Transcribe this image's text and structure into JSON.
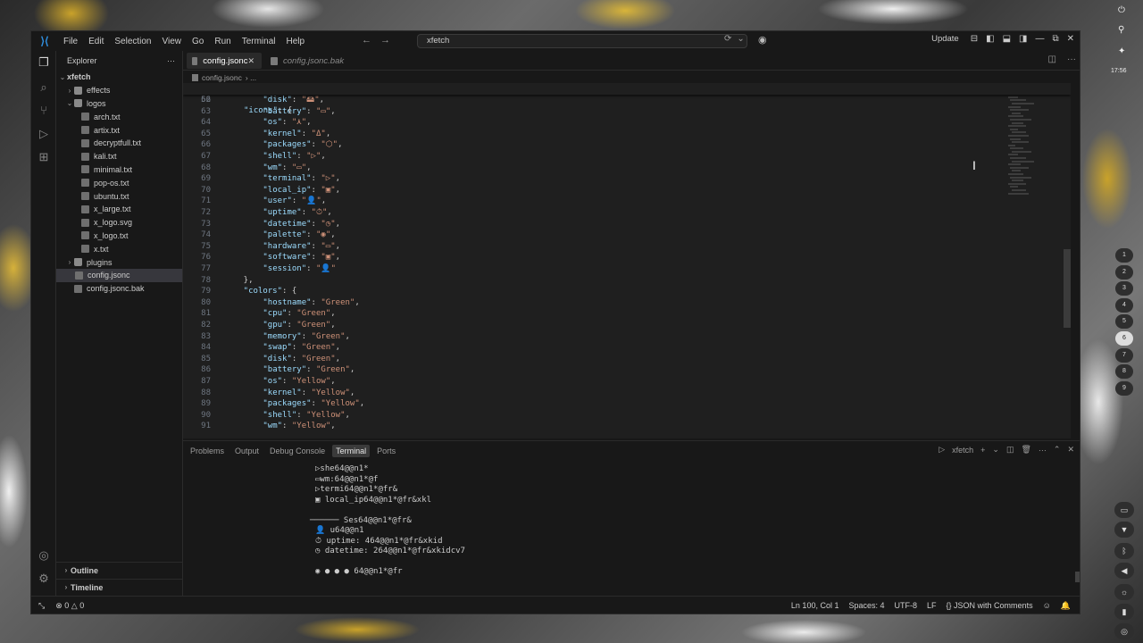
{
  "titlebar": {
    "menu": [
      "File",
      "Edit",
      "Selection",
      "View",
      "Go",
      "Run",
      "Terminal",
      "Help"
    ],
    "search_text": "xfetch",
    "update_label": "Update"
  },
  "sidebar": {
    "title": "Explorer",
    "more": "···",
    "root": "xfetch",
    "tree": [
      {
        "label": "effects",
        "kind": "folder",
        "depth": 1,
        "twisty": "›"
      },
      {
        "label": "logos",
        "kind": "folder",
        "depth": 1,
        "twisty": "⌄"
      },
      {
        "label": "arch.txt",
        "kind": "txt",
        "depth": 2
      },
      {
        "label": "artix.txt",
        "kind": "txt",
        "depth": 2
      },
      {
        "label": "decryptfull.txt",
        "kind": "txt",
        "depth": 2
      },
      {
        "label": "kali.txt",
        "kind": "txt",
        "depth": 2
      },
      {
        "label": "minimal.txt",
        "kind": "txt",
        "depth": 2
      },
      {
        "label": "pop-os.txt",
        "kind": "txt",
        "depth": 2
      },
      {
        "label": "ubuntu.txt",
        "kind": "txt",
        "depth": 2
      },
      {
        "label": "x_large.txt",
        "kind": "txt",
        "depth": 2
      },
      {
        "label": "x_logo.svg",
        "kind": "txt",
        "depth": 2
      },
      {
        "label": "x_logo.txt",
        "kind": "txt",
        "depth": 2
      },
      {
        "label": "x.txt",
        "kind": "txt",
        "depth": 2
      },
      {
        "label": "plugins",
        "kind": "folder",
        "depth": 1,
        "twisty": "›"
      },
      {
        "label": "config.jsonc",
        "kind": "cfg",
        "depth": 1,
        "selected": true
      },
      {
        "label": "config.jsonc.bak",
        "kind": "cfg",
        "depth": 1
      }
    ],
    "outline": "Outline",
    "timeline": "Timeline"
  },
  "tabs": [
    {
      "label": "config.jsonc",
      "active": true
    },
    {
      "label": "config.jsonc.bak",
      "active": false
    }
  ],
  "breadcrumb": {
    "file": "config.jsonc",
    "rest": "› ..."
  },
  "editor": {
    "sticky": {
      "n": "56",
      "key": "\"icons\"",
      "rest": ": {"
    },
    "lines": [
      {
        "n": "62",
        "key": "\"disk\"",
        "val": "\"🖴\"",
        "indent": 8
      },
      {
        "n": "63",
        "key": "\"battery\"",
        "val": "\"▭\"",
        "indent": 8
      },
      {
        "n": "64",
        "key": "\"os\"",
        "val": "\"⋏\"",
        "indent": 8
      },
      {
        "n": "65",
        "key": "\"kernel\"",
        "val": "\"Δ\"",
        "indent": 8
      },
      {
        "n": "66",
        "key": "\"packages\"",
        "val": "\"⬡\"",
        "indent": 8
      },
      {
        "n": "67",
        "key": "\"shell\"",
        "val": "\"▷\"",
        "indent": 8
      },
      {
        "n": "68",
        "key": "\"wm\"",
        "val": "\"▭\"",
        "indent": 8
      },
      {
        "n": "69",
        "key": "\"terminal\"",
        "val": "\"▷\"",
        "indent": 8
      },
      {
        "n": "70",
        "key": "\"local_ip\"",
        "val": "\"▣\"",
        "indent": 8
      },
      {
        "n": "71",
        "key": "\"user\"",
        "val": "\"👤\"",
        "indent": 8
      },
      {
        "n": "72",
        "key": "\"uptime\"",
        "val": "\"⏱\"",
        "indent": 8
      },
      {
        "n": "73",
        "key": "\"datetime\"",
        "val": "\"◷\"",
        "indent": 8
      },
      {
        "n": "74",
        "key": "\"palette\"",
        "val": "\"◉\"",
        "indent": 8
      },
      {
        "n": "75",
        "key": "\"hardware\"",
        "val": "\"▭\"",
        "indent": 8
      },
      {
        "n": "76",
        "key": "\"software\"",
        "val": "\"▣\"",
        "indent": 8
      },
      {
        "n": "77",
        "key": "\"session\"",
        "val": "\"👤\"",
        "indent": 8,
        "last": true
      },
      {
        "n": "78",
        "raw": "},",
        "indent": 4
      },
      {
        "n": "79",
        "key": "\"colors\"",
        "raw_after": ": {",
        "indent": 4
      },
      {
        "n": "80",
        "key": "\"hostname\"",
        "val": "\"Green\"",
        "indent": 8
      },
      {
        "n": "81",
        "key": "\"cpu\"",
        "val": "\"Green\"",
        "indent": 8
      },
      {
        "n": "82",
        "key": "\"gpu\"",
        "val": "\"Green\"",
        "indent": 8
      },
      {
        "n": "83",
        "key": "\"memory\"",
        "val": "\"Green\"",
        "indent": 8
      },
      {
        "n": "84",
        "key": "\"swap\"",
        "val": "\"Green\"",
        "indent": 8
      },
      {
        "n": "85",
        "key": "\"disk\"",
        "val": "\"Green\"",
        "indent": 8
      },
      {
        "n": "86",
        "key": "\"battery\"",
        "val": "\"Green\"",
        "indent": 8
      },
      {
        "n": "87",
        "key": "\"os\"",
        "val": "\"Yellow\"",
        "indent": 8
      },
      {
        "n": "88",
        "key": "\"kernel\"",
        "val": "\"Yellow\"",
        "indent": 8
      },
      {
        "n": "89",
        "key": "\"packages\"",
        "val": "\"Yellow\"",
        "indent": 8
      },
      {
        "n": "90",
        "key": "\"shell\"",
        "val": "\"Yellow\"",
        "indent": 8
      },
      {
        "n": "91",
        "key": "\"wm\"",
        "val": "\"Yellow\"",
        "indent": 8
      }
    ]
  },
  "panel": {
    "tabs": [
      "Problems",
      "Output",
      "Debug Console",
      "Terminal",
      "Ports"
    ],
    "active_tab": "Terminal",
    "terminal_name": "xfetch",
    "lines": [
      {
        "t": "▷she64@@n1*"
      },
      {
        "t": "▭wm:64@@n1*@f"
      },
      {
        "t": "▷termi64@@n1*@fr&"
      },
      {
        "t": "▣ local_ip64@@n1*@fr&xkl"
      },
      {
        "t": ""
      },
      {
        "t": "────── Ses64@@n1*@fr&"
      },
      {
        "t": "👤 u64@@n1"
      },
      {
        "t": "⏱ uptime: 464@@n1*@fr&xkid"
      },
      {
        "t": "◷ datetime: 264@@n1*@fr&xkidcv7"
      },
      {
        "t": ""
      },
      {
        "t": "◉ ● ● ● 64@@n1*@fr"
      }
    ]
  },
  "statusbar": {
    "errors": "0",
    "warnings": "0",
    "position": "Ln 100, Col 1",
    "spaces": "Spaces: 4",
    "encoding": "UTF-8",
    "eol": "LF",
    "language": "JSON with Comments"
  },
  "desktop": {
    "clock": "17:56",
    "workspaces": [
      "1",
      "2",
      "3",
      "4",
      "5",
      "6",
      "7",
      "8",
      "9"
    ],
    "active_workspace": "6"
  },
  "colors": {
    "json_key": "#9cdcfe",
    "json_string": "#ce9178",
    "editor_bg": "#1f1f1f",
    "chrome_bg": "#181818"
  }
}
